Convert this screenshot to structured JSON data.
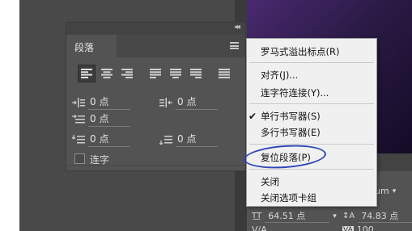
{
  "paragraph_panel": {
    "tab_label": "段落",
    "fields": [
      {
        "icon": "indent-left-icon",
        "value": "0 点"
      },
      {
        "icon": "indent-right-icon",
        "value": "0 点"
      },
      {
        "icon": "indent-first-line-icon",
        "value": "0 点"
      },
      {
        "icon": "space-before-icon",
        "value": "0 点"
      },
      {
        "icon": "space-after-icon",
        "value": "0 点"
      }
    ],
    "hyphenate_label": "连字"
  },
  "context_menu": {
    "items": [
      {
        "label": "罗马式溢出标点(R)",
        "checked": false
      },
      {
        "label": "对齐(J)...",
        "checked": false
      },
      {
        "label": "连字符连接(Y)...",
        "checked": false
      },
      {
        "label": "单行书写器(S)",
        "checked": true
      },
      {
        "label": "多行书写器(E)",
        "checked": false
      },
      {
        "label": "复位段落(P)",
        "checked": false
      },
      {
        "label": "关闭",
        "checked": false
      },
      {
        "label": "关闭选项卡组",
        "checked": false
      }
    ],
    "check_glyph": "✔"
  },
  "character_panel": {
    "font_weight": "dium",
    "font_size": "64.51 点",
    "leading": "74.83 点",
    "tracking_label": "V/A",
    "kerning_value": "100"
  },
  "colors": {
    "annotation": "#2f46b8",
    "menu_bg": "#f0f0f0",
    "panel_bg": "#535353"
  }
}
